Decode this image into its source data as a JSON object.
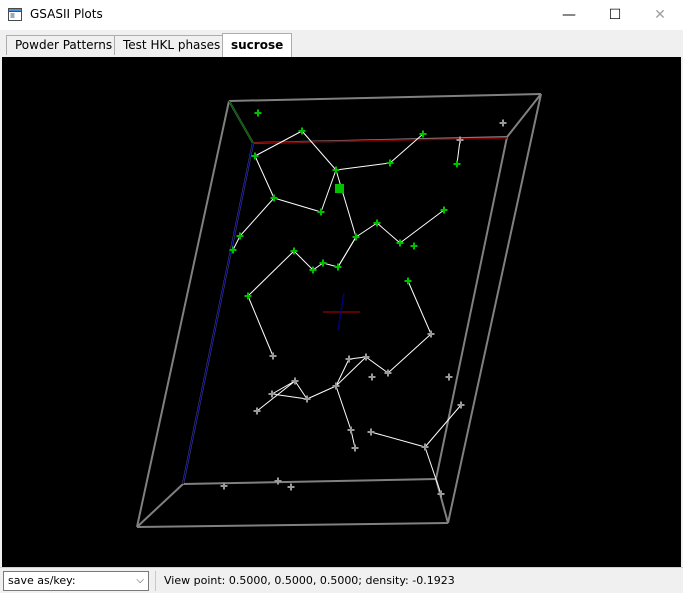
{
  "window": {
    "title": "GSASII Plots",
    "minimize_glyph": "—",
    "maximize_glyph": "☐",
    "close_glyph": "✕"
  },
  "tabs": [
    {
      "label": "Powder Patterns",
      "active": false
    },
    {
      "label": "Test HKL phases",
      "active": false
    },
    {
      "label": "sucrose",
      "active": true
    }
  ],
  "statusbar": {
    "save_select_value": "save as/key:",
    "status_text": "View point: 0.5000, 0.5000, 0.5000; density: -0.1923"
  },
  "colors": {
    "background": "#000000",
    "cell_edges": "#808080",
    "axis_a": "#7a0000",
    "axis_b": "#006000",
    "axis_c": "#00007a",
    "atom_green": "#00c000",
    "atom_gray": "#9a9a9a",
    "bond": "#ffffff"
  }
}
